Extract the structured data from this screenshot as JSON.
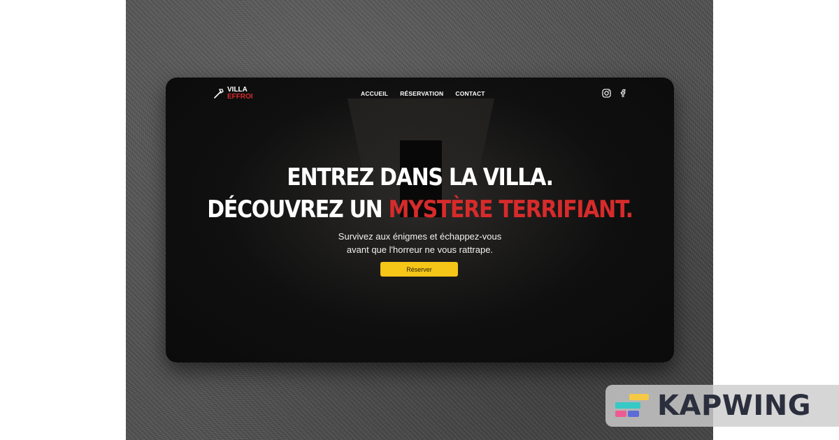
{
  "brand": {
    "line1": "VILLA",
    "line2": "EFFROI"
  },
  "nav": {
    "items": [
      "ACCUEIL",
      "RÉSERVATION",
      "CONTACT"
    ]
  },
  "social_icons": [
    "instagram-icon",
    "facebook-icon"
  ],
  "hero": {
    "line1": "ENTREZ DANS LA VILLA.",
    "line2_prefix": "DÉCOUVREZ UN ",
    "line2_highlight": "MYSTÈRE TERRIFIANT.",
    "subtitle_line1": "Survivez aux énigmes et échappez-vous",
    "subtitle_line2": "avant que l'horreur ne vous rattrape.",
    "cta_label": "Réserver"
  },
  "watermark": {
    "text": "KAPWING"
  },
  "colors": {
    "accent_red": "#d72b2b",
    "cta_yellow": "#f5c518",
    "card_bg": "#0b0b0b"
  }
}
